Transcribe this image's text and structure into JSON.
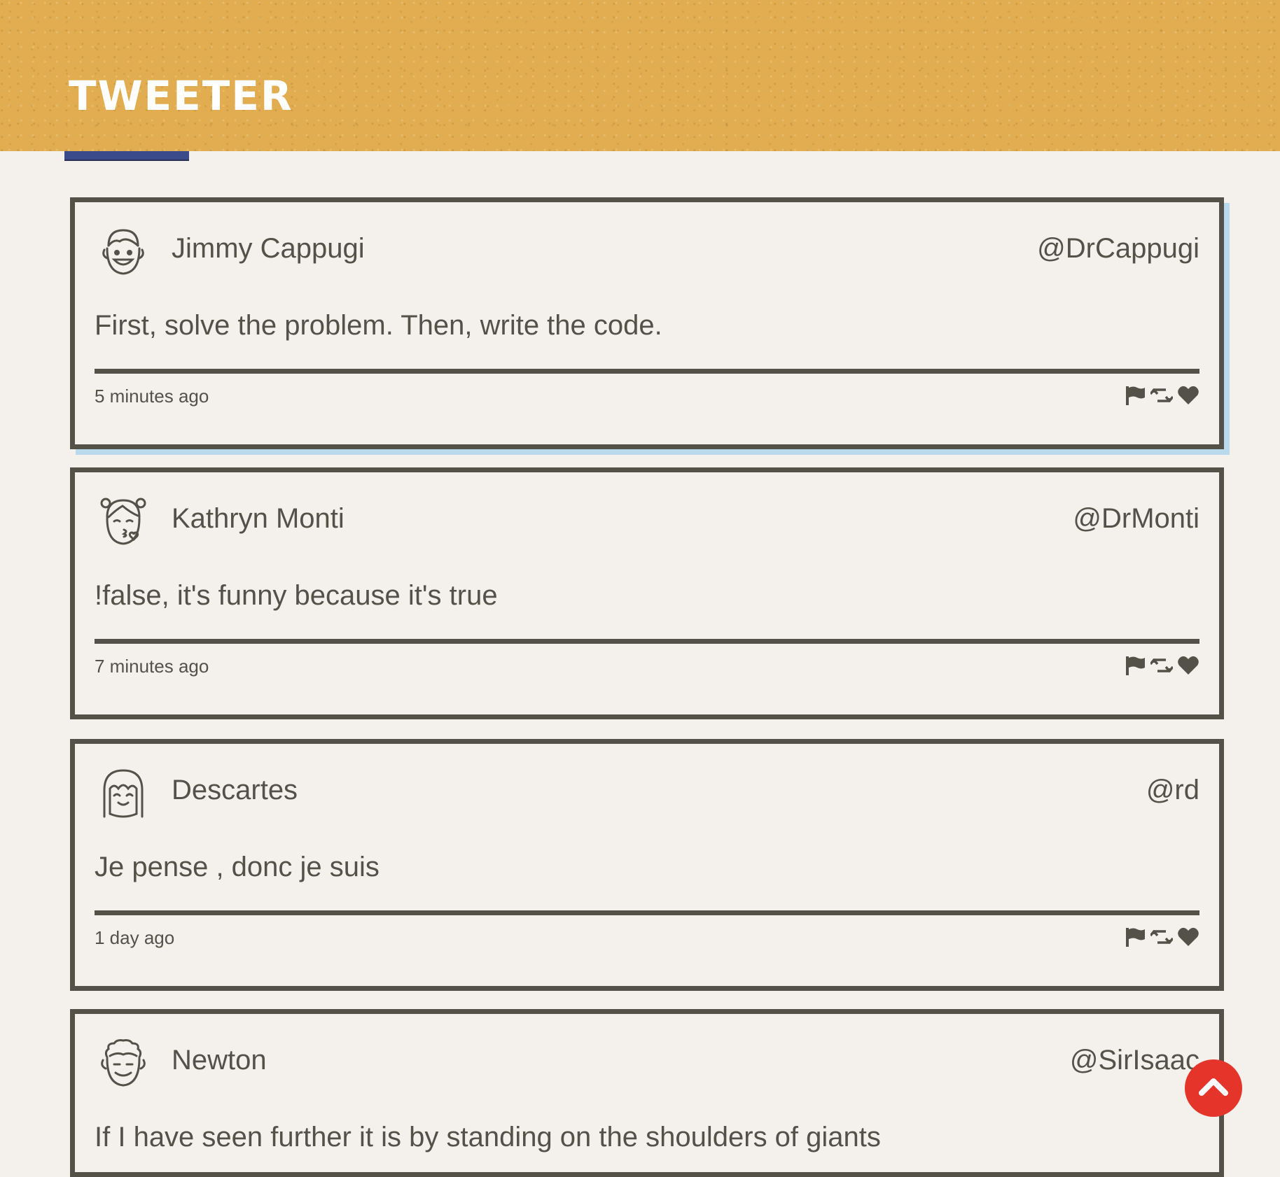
{
  "brand": {
    "title": "Tweeter"
  },
  "tweets": [
    {
      "name": "Jimmy Cappugi",
      "handle": "@DrCappugi",
      "content": "First, solve the problem. Then, write the code.",
      "time": "5 minutes ago",
      "avatar_icon": "smiling-man-avatar-icon"
    },
    {
      "name": "Kathryn Monti",
      "handle": "@DrMonti",
      "content": "!false, it's funny because it's true",
      "time": "7 minutes ago",
      "avatar_icon": "woman-kiss-avatar-icon"
    },
    {
      "name": "Descartes",
      "handle": "@rd",
      "content": "Je pense , donc je suis",
      "time": "1 day ago",
      "avatar_icon": "smiling-girl-avatar-icon"
    },
    {
      "name": "Newton",
      "handle": "@SirIsaac",
      "content": "If I have seen further it is by standing on the shoulders of giants",
      "time": "",
      "avatar_icon": "curly-hair-man-avatar-icon"
    }
  ],
  "actions": {
    "flag_icon": "flag-icon",
    "retweet_icon": "retweet-icon",
    "like_icon": "heart-icon"
  },
  "scroll_top": {
    "icon": "chevron-up-icon",
    "color": "#e5342a"
  },
  "colors": {
    "header": "#e2ad50",
    "background": "#f4f1ec",
    "ink": "#545149",
    "accent": "#3b4a8a",
    "highlight": "#b9d9ec"
  }
}
